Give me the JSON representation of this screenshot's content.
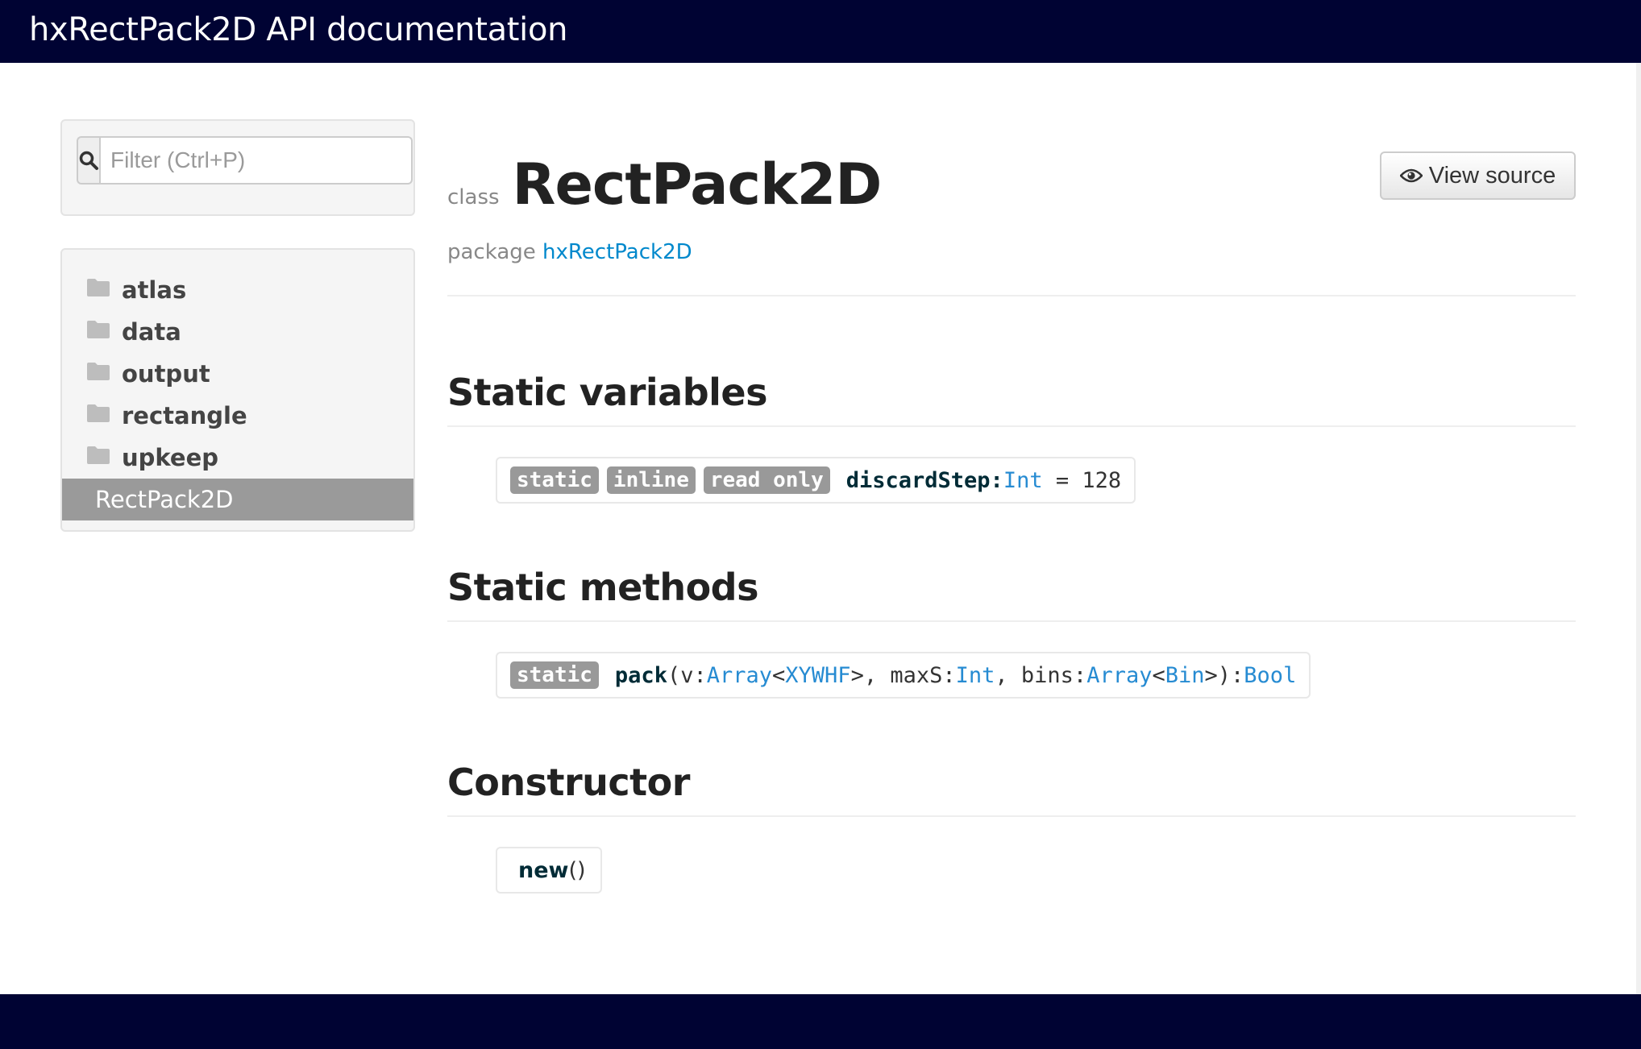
{
  "header": {
    "title": "hxRectPack2D API documentation"
  },
  "sidebar": {
    "filter_placeholder": "Filter (Ctrl+P)",
    "items": [
      {
        "label": "atlas",
        "type": "folder"
      },
      {
        "label": "data",
        "type": "folder"
      },
      {
        "label": "output",
        "type": "folder"
      },
      {
        "label": "rectangle",
        "type": "folder"
      },
      {
        "label": "upkeep",
        "type": "folder"
      },
      {
        "label": "RectPack2D",
        "type": "class",
        "selected": true
      }
    ]
  },
  "main": {
    "class_keyword": "class",
    "class_name": "RectPack2D",
    "view_source_label": "View source",
    "package_label": "package",
    "package_name": "hxRectPack2D",
    "sections": {
      "static_variables": {
        "title": "Static variables",
        "badges": [
          "static",
          "inline",
          "read only"
        ],
        "name": "discardStep",
        "colon": ":",
        "type": "Int",
        "assign": " = 128"
      },
      "static_methods": {
        "title": "Static methods",
        "badge": "static",
        "name": "pack",
        "p1": "(v:",
        "t1": "Array",
        "lt1": "<",
        "t2": "XYWHF",
        "p2": ">, maxS:",
        "t3": "Int",
        "p3": ", bins:",
        "t4": "Array",
        "lt2": "<",
        "t5": "Bin",
        "p4": ">):",
        "t6": "Bool"
      },
      "constructor": {
        "title": "Constructor",
        "name": "new",
        "parens": "()"
      }
    }
  },
  "colors": {
    "header_bg": "#000333",
    "link": "#0088cc",
    "type": "#268bd2",
    "badge": "#999999",
    "selected_nav": "#9a9a9a"
  },
  "icons": {
    "search": "search-icon",
    "folder": "folder-icon",
    "eye": "eye-icon"
  }
}
